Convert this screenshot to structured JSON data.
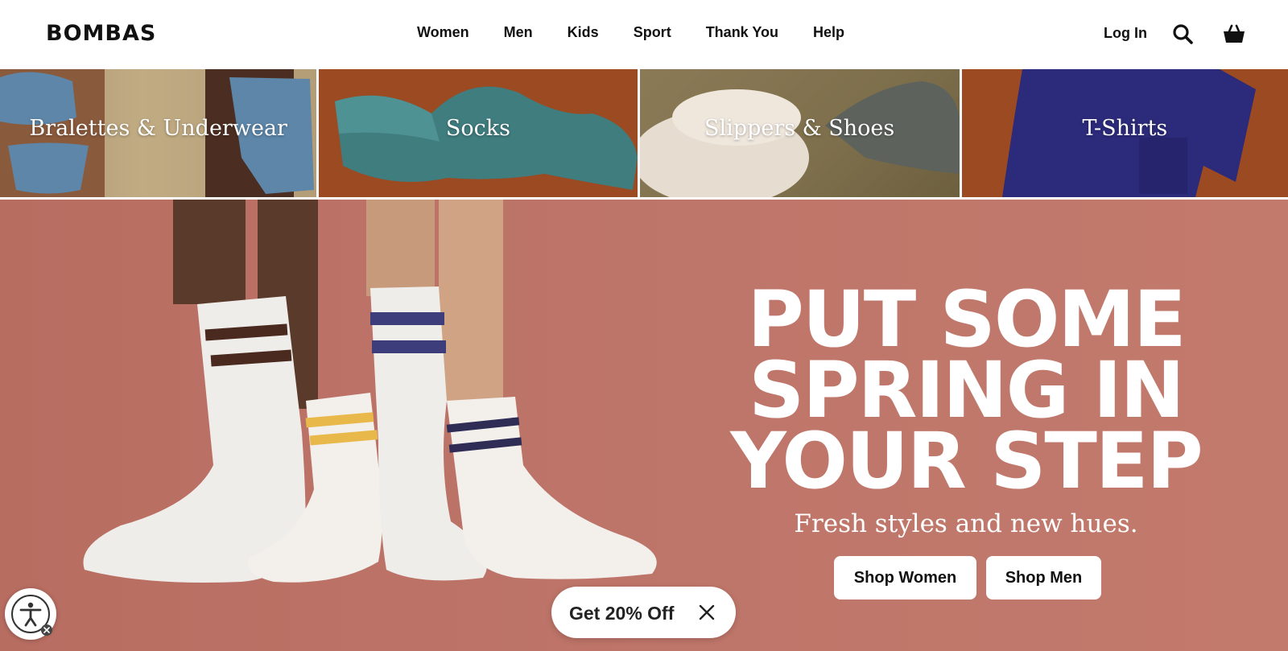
{
  "header": {
    "logo": "BOMBAS",
    "nav": [
      "Women",
      "Men",
      "Kids",
      "Sport",
      "Thank You",
      "Help"
    ],
    "login": "Log In"
  },
  "categories": [
    {
      "label": "Bralettes & Underwear"
    },
    {
      "label": "Socks"
    },
    {
      "label": "Slippers & Shoes"
    },
    {
      "label": "T-Shirts"
    }
  ],
  "hero": {
    "title_lines": [
      "PUT SOME",
      "SPRING IN",
      "YOUR STEP"
    ],
    "subtitle": "Fresh styles and new hues.",
    "shop_women": "Shop Women",
    "shop_men": "Shop Men"
  },
  "promo": {
    "label": "Get 20% Off"
  },
  "icons": {
    "search": "search-icon",
    "cart": "cart-icon",
    "close": "close-icon",
    "accessibility": "accessibility-icon"
  },
  "colors": {
    "hero_bg": "#bf766a",
    "category_rust": "#9b4a22",
    "text_dark": "#111111",
    "white": "#ffffff"
  }
}
